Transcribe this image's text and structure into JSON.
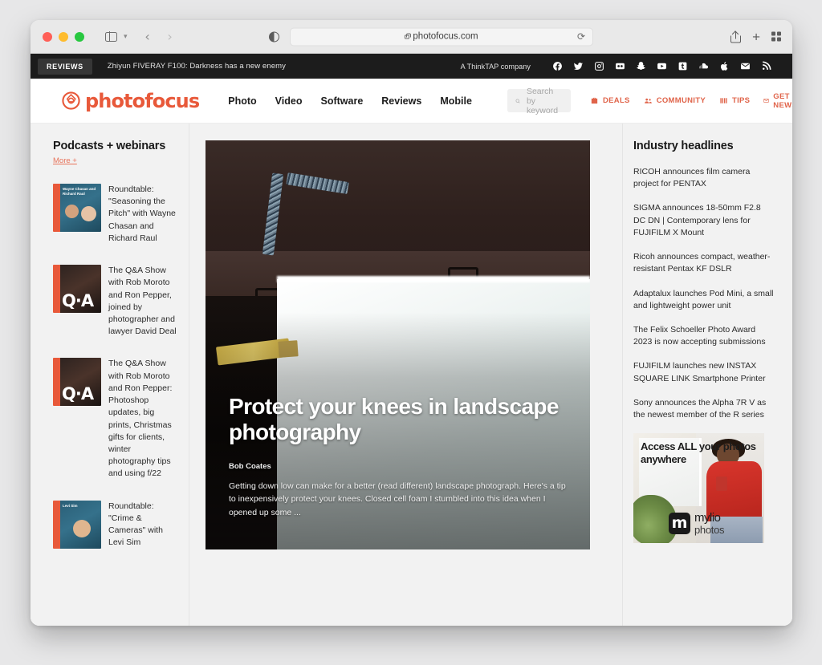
{
  "browser": {
    "url": "photofocus.com",
    "lock_icon": "lock-icon",
    "reload_icon": "reload-icon",
    "sidebar_icon": "sidebar-toggle-icon",
    "back_icon": "back-arrow-icon",
    "forward_icon": "forward-arrow-icon",
    "reader_icon": "reader-mode-icon",
    "share_icon": "share-icon",
    "newtab_icon": "plus-icon",
    "tabs_overview_icon": "tab-grid-icon"
  },
  "announce": {
    "badge": "REVIEWS",
    "headline": "Zhiyun FIVERAY F100: Darkness has a new enemy",
    "company": "A ThinkTAP company",
    "social": [
      {
        "name": "facebook-icon"
      },
      {
        "name": "twitter-icon"
      },
      {
        "name": "instagram-icon"
      },
      {
        "name": "flickr-icon"
      },
      {
        "name": "snapchat-icon"
      },
      {
        "name": "youtube-icon"
      },
      {
        "name": "tumblr-icon"
      },
      {
        "name": "soundcloud-icon"
      },
      {
        "name": "apple-icon"
      },
      {
        "name": "email-icon"
      },
      {
        "name": "rss-icon"
      }
    ]
  },
  "nav": {
    "menu_icon": "hamburger-icon",
    "brand": "photofocus",
    "links": [
      "Photo",
      "Video",
      "Software",
      "Reviews",
      "Mobile"
    ],
    "search_placeholder": "Search by keyword",
    "actions": [
      {
        "label": "DEALS",
        "icon": "briefcase-icon"
      },
      {
        "label": "COMMUNITY",
        "icon": "people-icon"
      },
      {
        "label": "TIPS",
        "icon": "list-icon"
      },
      {
        "label": "GET NEWS",
        "icon": "envelope-icon"
      }
    ]
  },
  "left_column": {
    "title": "Podcasts + webinars",
    "more_label": "More +",
    "podcasts": [
      {
        "title": "Roundtable: \"Seasoning the Pitch\" with Wayne Chasan and Richard Raul",
        "cover_text": "Wayne Chasan and Richard Raul",
        "art": "teal",
        "badge": ""
      },
      {
        "title": "The Q&A Show with Rob Moroto and Ron Pepper, joined by photographer and lawyer David Deal",
        "cover_text": "",
        "art": "dark",
        "badge": "Q·A"
      },
      {
        "title": "The Q&A Show with Rob Moroto and Ron Pepper: Photoshop updates, big prints, Christmas gifts for clients, winter photography tips and using f/22",
        "cover_text": "",
        "art": "dark",
        "badge": "Q·A"
      },
      {
        "title": "Roundtable: \"Crime & Cameras\" with Levi Sim",
        "cover_text": "Levi Sim",
        "art": "teal",
        "badge": ""
      }
    ]
  },
  "hero": {
    "title": "Protect your knees in landscape photography",
    "author": "Bob Coates",
    "excerpt": "Getting down low can make for a better (read different) landscape photograph. Here's a tip to inexpensively protect your knees. Closed cell foam I stumbled into this idea when I opened up some ..."
  },
  "right_column": {
    "title": "Industry headlines",
    "headlines": [
      "RICOH announces film camera project for PENTAX",
      "SIGMA announces 18-50mm F2.8 DC DN | Contemporary lens for FUJIFILM X Mount",
      "Ricoh announces compact, weather-resistant Pentax KF DSLR",
      "Adaptalux launches Pod Mini, a small and lightweight power unit",
      "The Felix Schoeller Photo Award 2023 is now accepting submissions",
      "FUJIFILM launches new INSTAX SQUARE LINK Smartphone Printer",
      "Sony announces the Alpha 7R V as the newest member of the R series"
    ],
    "ad": {
      "headline": "Access ALL your photos anywhere",
      "brand_line1": "mylio",
      "brand_line2": "photos"
    }
  },
  "colors": {
    "brand_orange": "#e8593a",
    "accent_coral": "#e0644a",
    "dark_bar": "#1c1c1c",
    "page_bg": "#f2f2f2"
  }
}
